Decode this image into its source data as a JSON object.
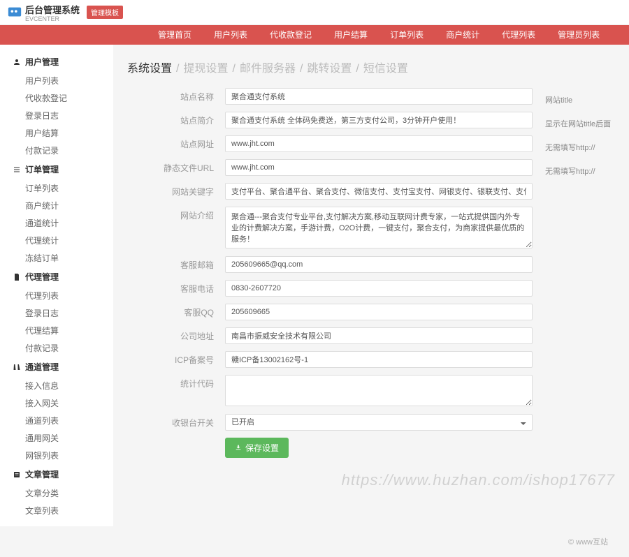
{
  "header": {
    "brand_main": "后台管理系统",
    "brand_sub": "EVCENTER",
    "badge": "管理模板"
  },
  "nav": [
    "管理首页",
    "用户列表",
    "代收款登记",
    "用户结算",
    "订单列表",
    "商户统计",
    "代理列表",
    "管理员列表"
  ],
  "sidebar": [
    {
      "title": "用户管理",
      "icon": "user-icon",
      "items": [
        "用户列表",
        "代收款登记",
        "登录日志",
        "用户结算",
        "付款记录"
      ]
    },
    {
      "title": "订单管理",
      "icon": "list-icon",
      "items": [
        "订单列表",
        "商户统计",
        "通道统计",
        "代理统计",
        "冻结订单"
      ]
    },
    {
      "title": "代理管理",
      "icon": "doc-icon",
      "items": [
        "代理列表",
        "登录日志",
        "代理结算",
        "付款记录"
      ]
    },
    {
      "title": "通道管理",
      "icon": "road-icon",
      "items": [
        "接入信息",
        "接入网关",
        "通道列表",
        "通用网关",
        "网银列表"
      ]
    },
    {
      "title": "文章管理",
      "icon": "article-icon",
      "items": [
        "文章分类",
        "文章列表"
      ]
    }
  ],
  "breadcrumb": [
    "系统设置",
    "提现设置",
    "邮件服务器",
    "跳转设置",
    "短信设置"
  ],
  "form": {
    "rows": [
      {
        "label": "站点名称",
        "type": "input",
        "value": "聚合通支付系统",
        "hint": "网站title"
      },
      {
        "label": "站点简介",
        "type": "input",
        "value": "聚合通支付系统 全体码免费送，第三方支付公司，3分钟开户使用！",
        "hint": "显示在网站title后面"
      },
      {
        "label": "站点网址",
        "type": "input",
        "value": "www.jht.com",
        "hint": "无需填写http://"
      },
      {
        "label": "静态文件URL",
        "type": "input",
        "value": "www.jht.com",
        "hint": "无需填写http://"
      },
      {
        "label": "网站关键字",
        "type": "input",
        "value": "支付平台、聚合通平台、聚合支付、微信支付、支付宝支付、网银支付、银联支付、支付接口、支付通道、聚合",
        "hint": ""
      },
      {
        "label": "网站介绍",
        "type": "textarea",
        "value": "聚合通---聚合支付专业平台,支付解决方案,移动互联网计费专家，一站式提供国内外专业的计费解决方案，手游计费，O2O计费，一键支付，聚合支付，为商家提供最优质的服务！",
        "height": 60,
        "hint": ""
      },
      {
        "label": "客服邮箱",
        "type": "input",
        "value": "205609665@qq.com",
        "hint": ""
      },
      {
        "label": "客服电话",
        "type": "input",
        "value": "0830-2607720",
        "hint": ""
      },
      {
        "label": "客服QQ",
        "type": "input",
        "value": "205609665",
        "hint": ""
      },
      {
        "label": "公司地址",
        "type": "input",
        "value": "南昌市振威安全技术有限公司",
        "hint": ""
      },
      {
        "label": "ICP备案号",
        "type": "input",
        "value": "赣ICP备13002162号-1",
        "hint": ""
      },
      {
        "label": "统计代码",
        "type": "textarea",
        "value": "",
        "height": 45,
        "hint": ""
      },
      {
        "label": "收银台开关",
        "type": "select",
        "value": "已开启",
        "hint": ""
      }
    ],
    "save_label": "保存设置"
  },
  "footer": "© www互站",
  "watermark": "https://www.huzhan.com/ishop17677"
}
